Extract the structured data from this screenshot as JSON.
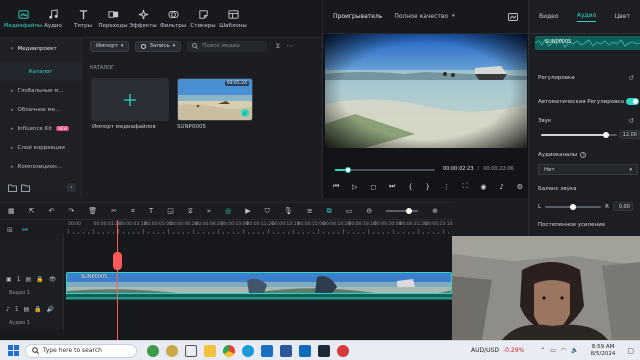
{
  "toolbar": {
    "items": [
      {
        "label": "Медиафайлы",
        "icon": "media-icon"
      },
      {
        "label": "Аудио",
        "icon": "music-icon"
      },
      {
        "label": "Титры",
        "icon": "text-icon"
      },
      {
        "label": "Переходы",
        "icon": "transition-icon"
      },
      {
        "label": "Эффекты",
        "icon": "effects-icon"
      },
      {
        "label": "Фильтры",
        "icon": "filter-icon"
      },
      {
        "label": "Стикеры",
        "icon": "sticker-icon"
      },
      {
        "label": "Шаблоны",
        "icon": "template-icon"
      }
    ],
    "active_index": 0
  },
  "leftnav": {
    "header": "Медиапроект",
    "catalog": "Каталог",
    "items": [
      {
        "label": "Глобальные м..."
      },
      {
        "label": "Облачное ме..."
      },
      {
        "label": "Influence Kit",
        "badge": "NEW"
      },
      {
        "label": "Слой коррекции"
      },
      {
        "label": "Композицион..."
      }
    ]
  },
  "media": {
    "import_label": "Импорт",
    "record_label": "Запись",
    "search_placeholder": "Поиск медиа",
    "section_label": "КАТАЛОГ",
    "import_card_label": "Импорт медиафайлов",
    "clip": {
      "name": "SUNP0005",
      "duration": "00:05:24"
    }
  },
  "preview": {
    "tab_player": "Проигрыватель",
    "quality": "Полное качество",
    "current_time": "00:00:02:23",
    "total_time": "00:00:22:06",
    "progress": 0.13
  },
  "rightpanel": {
    "tab_video": "Видео",
    "tab_audio": "Аудио",
    "tab_color": "Цвет",
    "clip_name": "SUNP0005",
    "adjust_label": "Регулировка",
    "auto_adjust_label": "Автоматическая Регулировка",
    "volume_label": "Звук",
    "volume_value": "12,00",
    "volume_level": 0.85,
    "channels_label": "Аудиоканалы",
    "channels_value": "Нет",
    "balance_label": "Баланс звука",
    "balance_l": "L",
    "balance_r": "R",
    "balance_value": "0,00",
    "fade_label": "Постепенное усиление"
  },
  "timeline": {
    "ruler_labels": [
      "00:00",
      "00:00:01:20",
      "00:00:03:10",
      "00:00:05:00",
      "00:00:06:20",
      "00:00:08:10",
      "00:00:10:00",
      "00:00:11:20",
      "00:00:13:10",
      "00:00:15:00",
      "00:00:16:20",
      "00:00:18:10",
      "00:00:20:00",
      "00:00:21:20",
      "00:00:23:10"
    ],
    "video_track_label": "Видео 1",
    "audio_track_label": "Аудио 1",
    "track_video_num": "1",
    "track_audio_num": "1",
    "clip_name": "SUNP0005"
  },
  "taskbar": {
    "search_placeholder": "Type here to search",
    "stock_symbol": "AUD/USD",
    "stock_change": "-0.29%",
    "time": "8:59 AM",
    "date": "8/5/2024"
  },
  "colors": {
    "accent": "#2fd6c3",
    "playhead": "#ff5a5a",
    "clip_teal": "#1a8f86"
  }
}
